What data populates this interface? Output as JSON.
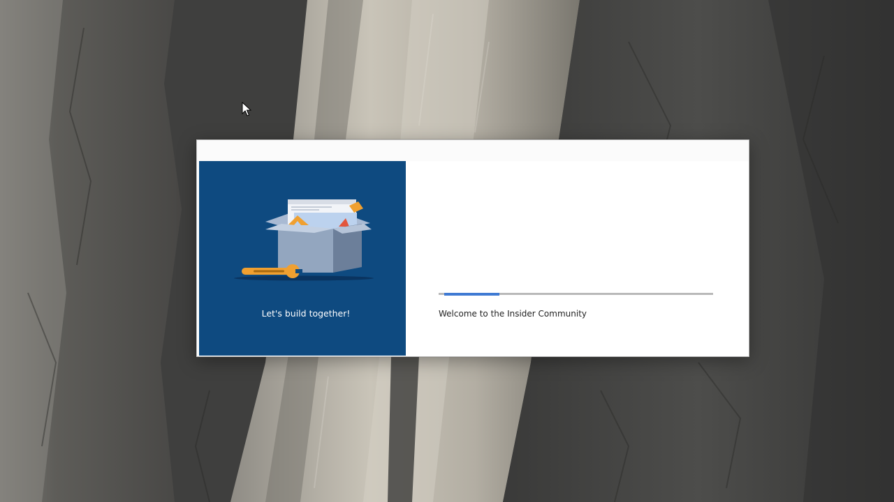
{
  "desktop": {
    "wallpaper": "rock-cliff-wallpaper"
  },
  "installer": {
    "hero": {
      "caption": "Let's build together!",
      "illustration": "open-toolbox-illustration",
      "background_color": "#0e4a80"
    },
    "progress": {
      "fraction": 0.2
    },
    "status_text": "Welcome to the Insider Community",
    "accent_color": "#3f7ad3"
  }
}
